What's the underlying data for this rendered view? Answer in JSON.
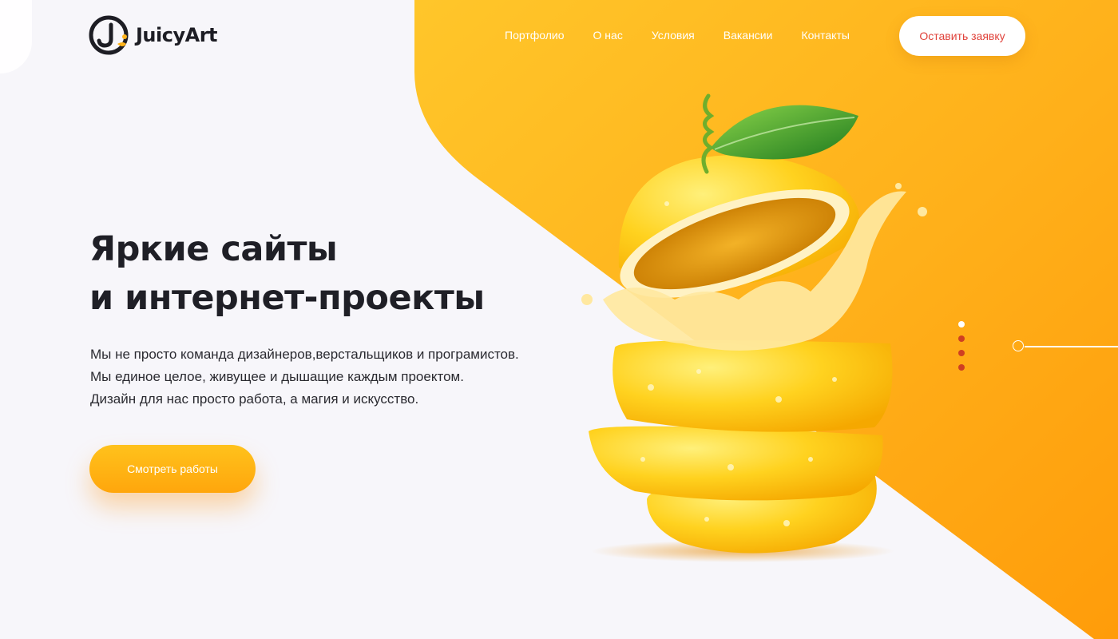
{
  "brand": {
    "name": "JuicyArt",
    "accent": "#ffa90e",
    "dark": "#1d1d24",
    "cta_text_color": "#e0423a"
  },
  "nav": {
    "items": [
      {
        "label": "Портфолио"
      },
      {
        "label": "О нас"
      },
      {
        "label": "Условия"
      },
      {
        "label": "Вакансии"
      },
      {
        "label": "Контакты"
      }
    ],
    "cta_label": "Оставить заявку"
  },
  "hero": {
    "title_lines": [
      "Яркие сайты",
      "и интернет-проекты"
    ],
    "description_lines": [
      "Мы не просто команда дизайнеров,верстальщиков и програмистов.",
      "Мы единое целое, живущее и дышащие каждым проектом.",
      "Дизайн для нас просто работа, а магия и искусство."
    ],
    "button_label": "Смотреть работы"
  },
  "slider": {
    "total": 4,
    "active": 1
  },
  "icons": {
    "logo": "juicyart-logo-icon",
    "hero_image": "sliced-orange-juice-splash-illustration",
    "slider_ring": "circle-outline-icon"
  }
}
